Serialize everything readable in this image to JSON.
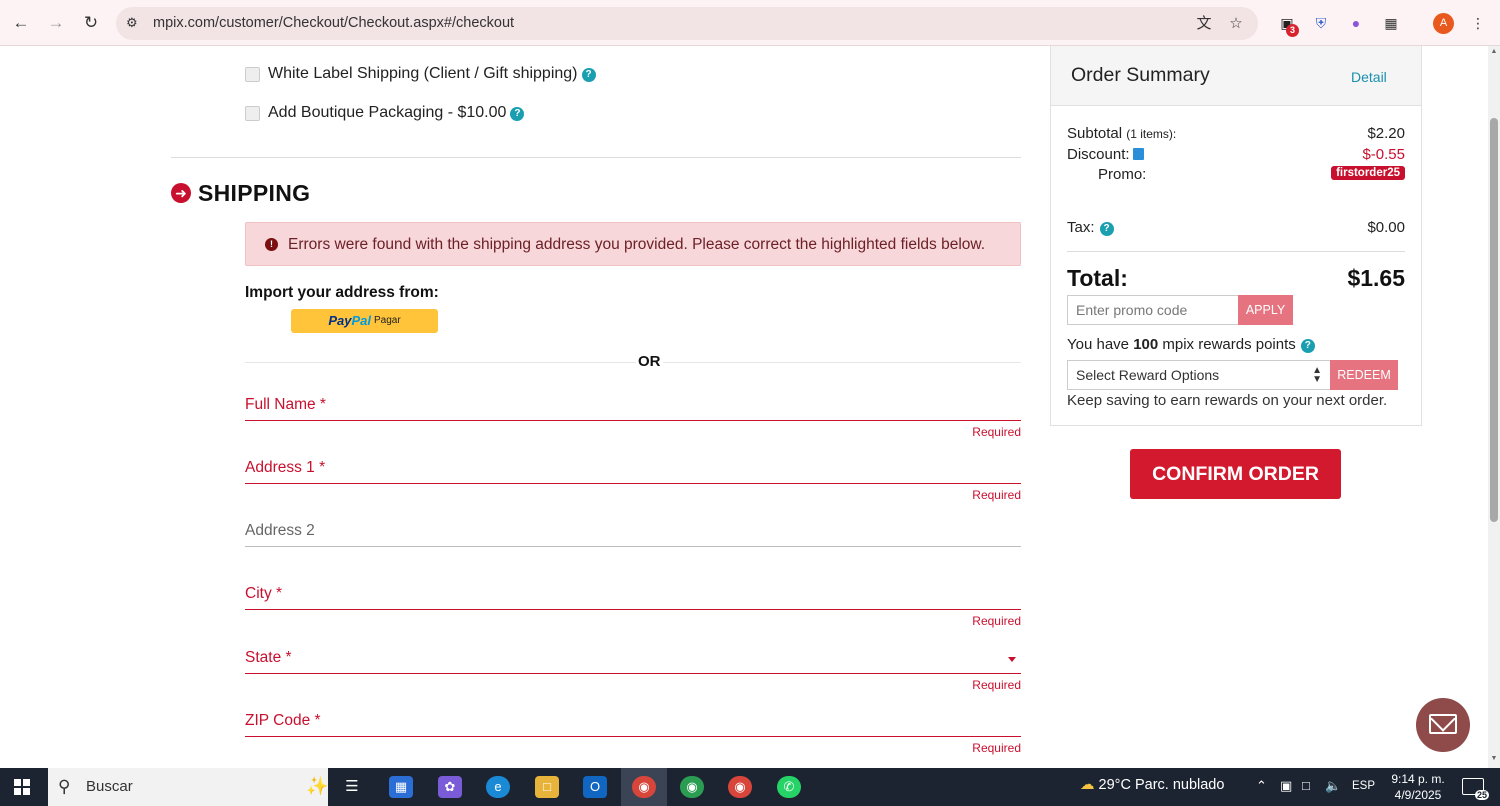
{
  "browser": {
    "url": "mpix.com/customer/Checkout/Checkout.aspx#/checkout",
    "extension_badge": "3",
    "profile_initial": "A"
  },
  "options": {
    "white_label": "White Label Shipping (Client / Gift shipping)",
    "boutique": "Add Boutique Packaging - $10.00"
  },
  "shipping": {
    "title": "SHIPPING",
    "error": "Errors were found with the shipping address you provided. Please correct the highlighted fields below.",
    "import_label": "Import your address from:",
    "paypal_pay": "Pay",
    "paypal_pal": "Pal",
    "paypal_action": "Pagar",
    "or": "OR",
    "fields": [
      {
        "label": "Full Name *",
        "error": "Required"
      },
      {
        "label": "Address 1 *",
        "error": "Required"
      },
      {
        "label": "Address 2",
        "error": ""
      },
      {
        "label": "City *",
        "error": "Required"
      },
      {
        "label": "State *",
        "error": "Required"
      },
      {
        "label": "ZIP Code *",
        "error": "Required"
      }
    ]
  },
  "summary": {
    "title": "Order Summary",
    "detail": "Detail",
    "subtotal_label": "Subtotal",
    "subtotal_items": "(1 items):",
    "subtotal_value": "$2.20",
    "discount_label": "Discount:",
    "discount_value": "$-0.55",
    "promo_label": "Promo:",
    "promo_code": "firstorder25",
    "tax_label": "Tax:",
    "tax_value": "$0.00",
    "total_label": "Total:",
    "total_value": "$1.65",
    "promo_placeholder": "Enter promo code",
    "apply": "APPLY",
    "rewards_pre": "You have",
    "rewards_points": "100",
    "rewards_post": "mpix rewards points",
    "reward_select": "Select Reward Options",
    "redeem": "REDEEM",
    "keep_saving": "Keep saving to earn rewards on your next order."
  },
  "confirm": "CONFIRM ORDER",
  "taskbar": {
    "search": "Buscar",
    "weather": "29°C  Parc. nublado",
    "lang": "ESP",
    "time": "9:14 p. m.",
    "date": "4/9/2025",
    "notif_count": "25"
  }
}
